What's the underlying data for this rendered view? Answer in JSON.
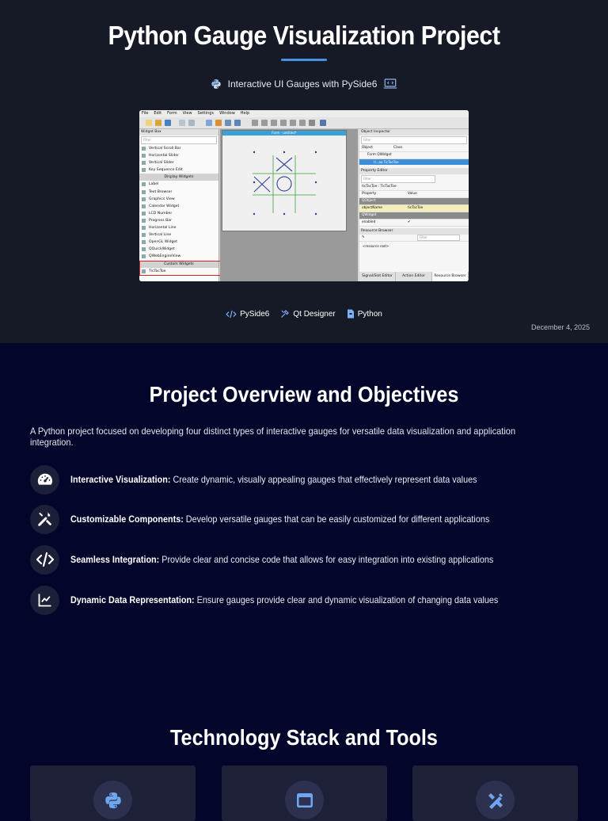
{
  "hero": {
    "title": "Python Gauge Visualization Project",
    "subtitle": "Interactive UI Gauges with PySide6",
    "date": "December 4, 2025",
    "accent": "#4a90e2"
  },
  "screenshot": {
    "menus": [
      "File",
      "Edit",
      "Form",
      "View",
      "Settings",
      "Window",
      "Help"
    ],
    "widget_box": {
      "title": "Widget Box",
      "filter_placeholder": "Filter",
      "items": [
        {
          "label": "Vertical Scroll Bar"
        },
        {
          "label": "Horizontal Slider"
        },
        {
          "label": "Vertical Slider"
        },
        {
          "label": "Key Sequence Edit"
        },
        {
          "label": "Display Widgets",
          "category": true
        },
        {
          "label": "Label"
        },
        {
          "label": "Text Browser"
        },
        {
          "label": "Graphics View"
        },
        {
          "label": "Calendar Widget"
        },
        {
          "label": "LCD Number"
        },
        {
          "label": "Progress Bar"
        },
        {
          "label": "Horizontal Line"
        },
        {
          "label": "Vertical Line"
        },
        {
          "label": "OpenGL Widget"
        },
        {
          "label": "QQuickWidget"
        },
        {
          "label": "QWebEngineView"
        },
        {
          "label": "Custom Widgets",
          "category": true
        },
        {
          "label": "TicTacToe"
        }
      ]
    },
    "form_title": "Form - untitled*",
    "object_inspector": {
      "title": "Object Inspector",
      "filter_placeholder": "Filter",
      "col_object": "Object",
      "col_class": "Class",
      "row_form": "Form  QWidget",
      "row_selected": "ti...oe  TicTacToe"
    },
    "property_editor": {
      "title": "Property Editor",
      "filter_placeholder": "Filter",
      "context": "ticTacToe : TicTacToe",
      "col_property": "Property",
      "col_value": "Value",
      "rows": [
        {
          "property": "QObject",
          "value": "",
          "group": true
        },
        {
          "property": "objectName",
          "value": "ticTacToe",
          "highlight": true
        },
        {
          "property": "QWidget",
          "value": "",
          "group": true
        },
        {
          "property": "enabled",
          "value": "✔"
        }
      ]
    },
    "resource_browser": {
      "title": "Resource Browser",
      "filter_placeholder": "Filter",
      "root": "<resource root>"
    },
    "tabs": [
      "Signal/Slot Editor",
      "Action Editor",
      "Resource Browser"
    ]
  },
  "tech_tags": [
    {
      "icon": "code-icon",
      "label": "PySide6"
    },
    {
      "icon": "tools-icon",
      "label": "Qt Designer"
    },
    {
      "icon": "python-file-icon",
      "label": "Python"
    }
  ],
  "overview": {
    "title": "Project Overview and Objectives",
    "intro": "A Python project focused on developing four distinct types of interactive gauges for versatile data visualization and application integration.",
    "objectives": [
      {
        "icon": "gauge-icon",
        "title": "Interactive Visualization:",
        "text": " Create dynamic, visually appealing gauges that effectively represent data values"
      },
      {
        "icon": "tools-icon",
        "title": "Customizable Components:",
        "text": " Develop versatile gauges that can be easily customized for different applications"
      },
      {
        "icon": "code-icon",
        "title": "Seamless Integration:",
        "text": " Provide clear and concise code that allows for easy integration into existing applications"
      },
      {
        "icon": "chart-line-icon",
        "title": "Dynamic Data Representation:",
        "text": " Ensure gauges provide clear and dynamic visualization of changing data values"
      }
    ]
  },
  "stack": {
    "title": "Technology Stack and Tools",
    "cards": [
      {
        "icon": "python-icon"
      },
      {
        "icon": "window-icon"
      },
      {
        "icon": "design-tools-icon"
      }
    ]
  }
}
